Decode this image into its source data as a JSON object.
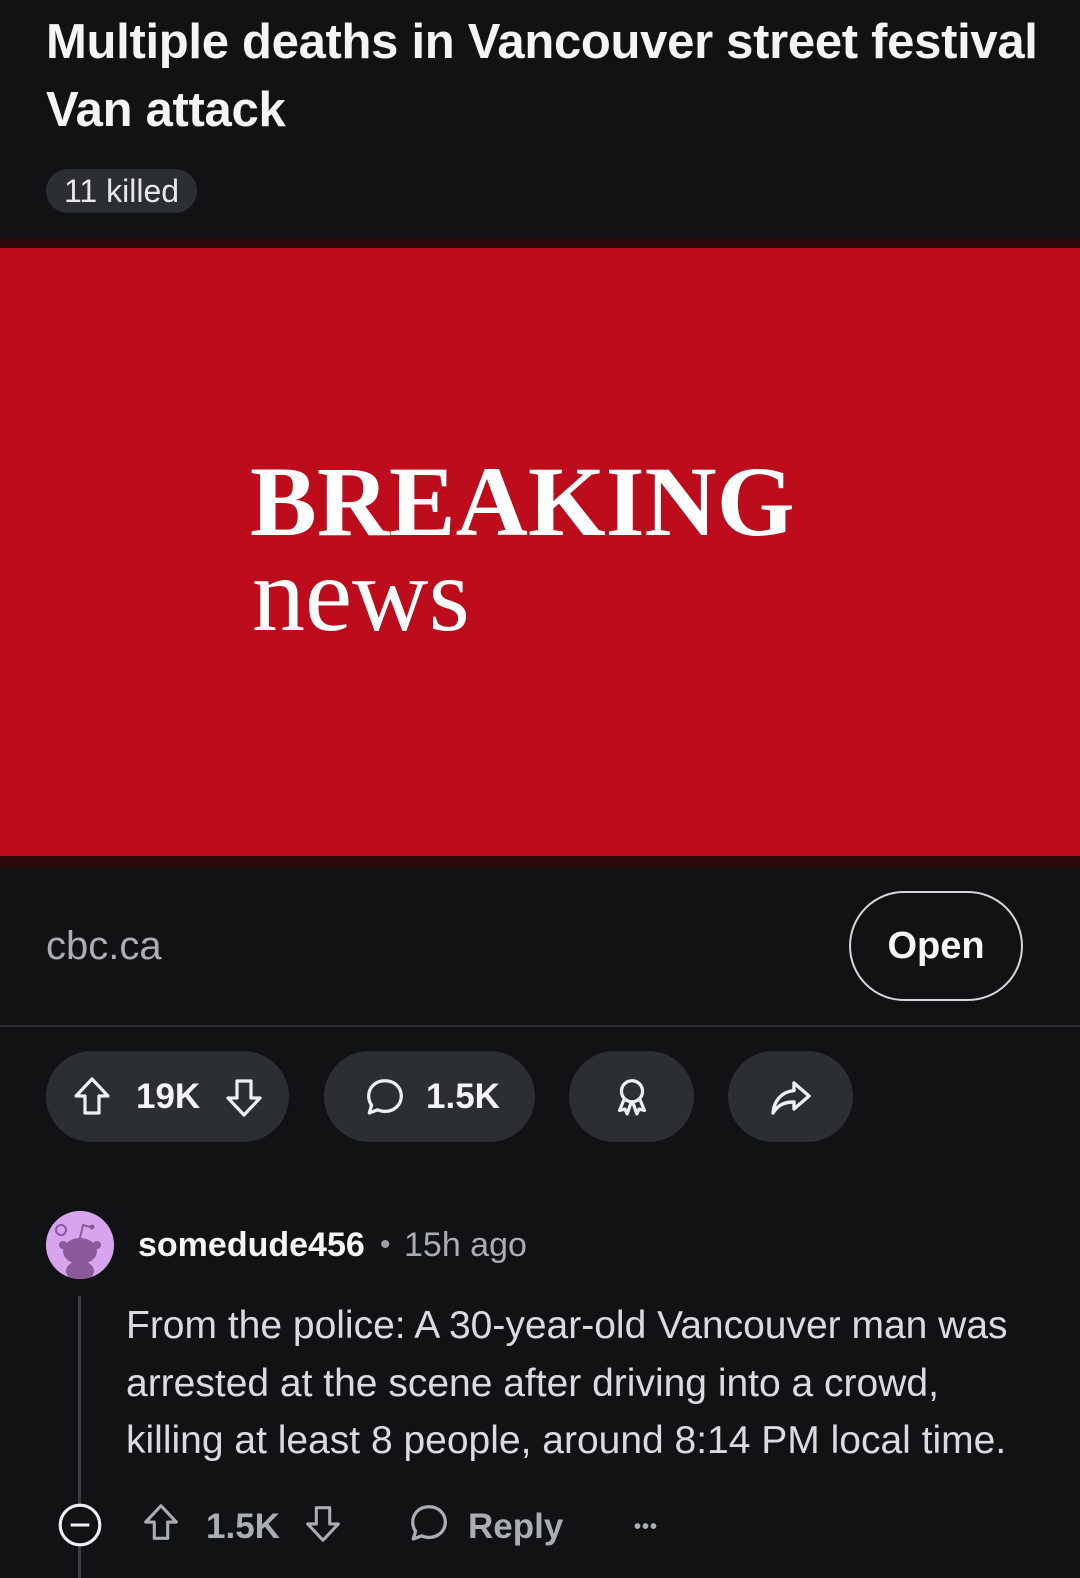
{
  "post": {
    "title": "Multiple deaths in Vancouver street festival Van attack",
    "flair": "11 killed",
    "media": {
      "line1": "BREAKING",
      "line2": "news",
      "background_color": "#bd0c1b"
    },
    "link_domain": "cbc.ca",
    "open_label": "Open"
  },
  "actions": {
    "vote_count": "19K",
    "comment_count": "1.5K",
    "award_icon": "award-icon",
    "share_icon": "share-icon"
  },
  "comment": {
    "username": "somedude456",
    "separator": "•",
    "time_ago": "15h ago",
    "body": "From the police: A 30-year-old Vancouver man was arrested at the scene after driving into a crowd, killing at least 8 people, around 8:14 PM local time.",
    "vote_count": "1.5K",
    "reply_label": "Reply",
    "more_label": "•••"
  }
}
